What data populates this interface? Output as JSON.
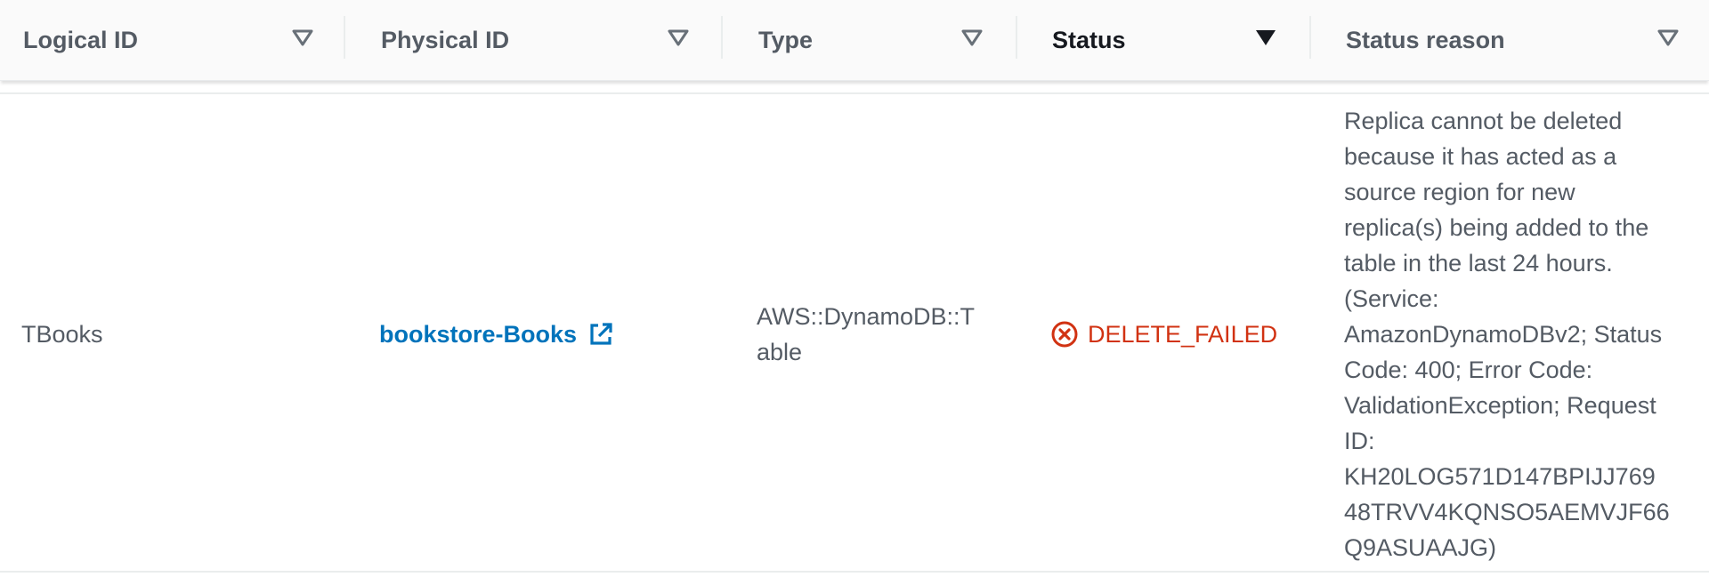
{
  "columns": [
    {
      "label": "Logical ID",
      "sorted": false
    },
    {
      "label": "Physical ID",
      "sorted": false
    },
    {
      "label": "Type",
      "sorted": false
    },
    {
      "label": "Status",
      "sorted": true
    },
    {
      "label": "Status reason",
      "sorted": false
    }
  ],
  "row": {
    "logical_id": "TBooks",
    "physical_id": "bookstore-Books",
    "physical_id_icon": "external-link-icon",
    "type_line1": "AWS::DynamoDB::T",
    "type_line2": "able",
    "status": "DELETE_FAILED",
    "status_icon": "error-circle-icon",
    "status_reason_lines": [
      "Replica cannot be deleted",
      "because it has acted as a",
      "source region for new",
      "replica(s) being added to the",
      "table in the last 24 hours.",
      "(Service:",
      "AmazonDynamoDBv2; Status",
      "Code: 400; Error Code:",
      "ValidationException; Request",
      "ID:",
      "KH20LOG571D147BPIJJ769",
      "48TRVV4KQNSO5AEMVJF66",
      "Q9ASUAAJG)"
    ]
  },
  "colors": {
    "link": "#0073bb",
    "error": "#d13212",
    "text": "#545b64",
    "header_bg": "#fafafa"
  }
}
